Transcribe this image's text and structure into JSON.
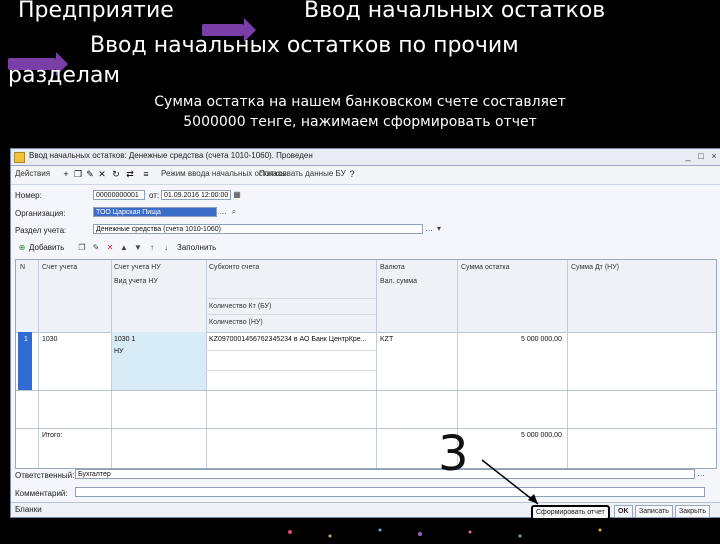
{
  "slide": {
    "title_left": "Предприятие",
    "title_right": "Ввод начальных остатков",
    "title_line2": "Ввод начальных остатков по прочим",
    "title_line3": "разделам",
    "subtitle_line1": "Сумма остатка на нашем банковском счете составляет",
    "subtitle_line2": "5000000 тенге, нажимаем сформировать отчет",
    "annotation_number": "3"
  },
  "window": {
    "title": "Ввод начальных остатков: Денежные средства (счета 1010-1060). Проведен",
    "toolbar": {
      "actions_label": "Действия",
      "post_mode_label": "Режим ввода начальных остатков",
      "show_label": "Показывать данные БУ"
    },
    "form": {
      "number_label": "Номер:",
      "number_value": "00000000001",
      "date_label": "от:",
      "date_value": "01.09.2016 12:00:00",
      "org_label": "Организация:",
      "org_value": "ТОО Царская Пища",
      "section_label": "Раздел учета:",
      "section_value": "Денежные средства (счета 1010-1060)"
    },
    "table_toolbar": {
      "add_label": "Добавить",
      "fill_label": "Заполнить"
    },
    "grid": {
      "headers": {
        "col_n": "N",
        "col_account": "Счет учета",
        "col_account_nu": "Счет учета НУ",
        "col_type_nu": "Вид учета НУ",
        "col_subconto": "Субконто счета",
        "col_qty_kt": "Количество Кт (БУ)",
        "col_qty_nu": "Количество (НУ)",
        "col_currency": "Валюта",
        "col_currency_amount": "Вал. сумма",
        "col_amount": "Сумма остатка",
        "col_amount_nu": "Сумма Дт (НУ)"
      },
      "rows": [
        {
          "n": "1",
          "account": "1030",
          "account_nu": "1030 1",
          "type_nu": "НУ",
          "subconto": "KZ0970001456762345234 в АО Банк ЦентрКре...",
          "currency": "KZT",
          "amount": "5 000 000,00"
        }
      ],
      "total_label": "Итого:",
      "total_amount": "5 000 000,00"
    },
    "responsible_label": "Ответственный:",
    "responsible_value": "Бухгалтер",
    "comment_label": "Комментарий:",
    "comment_value": "",
    "footer": {
      "gen_label": "Бланки",
      "form_report_label": "Сформировать отчет",
      "ok_label": "OK",
      "save_label": "Записать",
      "close_label": "Закрыть"
    }
  }
}
